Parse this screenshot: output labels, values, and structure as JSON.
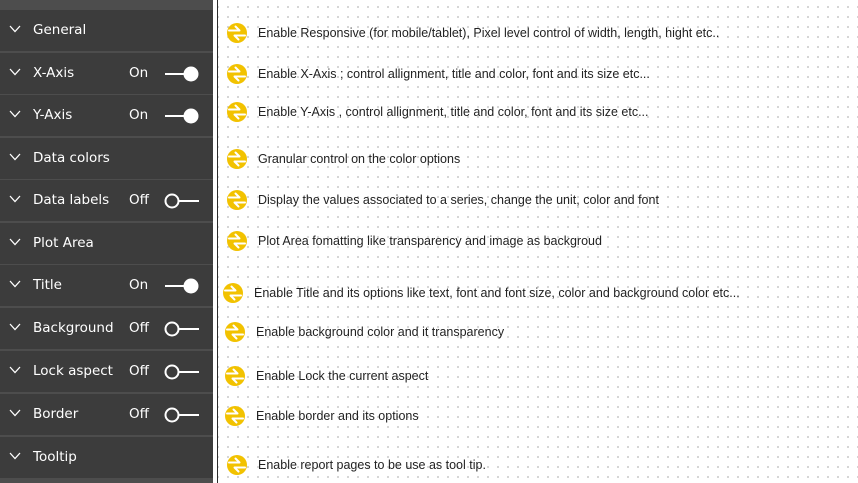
{
  "colors": {
    "panel_background": "#3c3c3c",
    "panel_text": "#ffffff",
    "bullet_fill": "#f2c200",
    "body_text": "#222222"
  },
  "icons": {
    "expander": "chevron-down-icon",
    "toggle": "toggle-switch-icon",
    "bullet": "yellow-arrow-bullet-icon"
  },
  "format_pane": {
    "items": [
      {
        "id": "general",
        "label": "General",
        "state": "",
        "description": "Enable Responsive (for mobile/tablet), Pixel level control of width, length, hight etc.."
      },
      {
        "id": "x-axis",
        "label": "X-Axis",
        "state": "On",
        "description": "Enable X-Axis ; control allignment, title and color, font and its size etc..."
      },
      {
        "id": "y-axis",
        "label": "Y-Axis",
        "state": "On",
        "description": "Enable Y-Axis , control allignment, title and color, font and its size etc..."
      },
      {
        "id": "data-colors",
        "label": "Data colors",
        "state": "",
        "description": "Granular control on the color options"
      },
      {
        "id": "data-labels",
        "label": "Data labels",
        "state": "Off",
        "description": "Display the values associated to a series, change the unit, color and font"
      },
      {
        "id": "plot-area",
        "label": "Plot Area",
        "state": "",
        "description": "Plot Area fomatting like transparency and image as backgroud"
      },
      {
        "id": "title",
        "label": "Title",
        "state": "On",
        "description": "Enable Title and its options like text, font and font size, color and background color etc..."
      },
      {
        "id": "background",
        "label": "Background",
        "state": "Off",
        "description": "Enable background color and it transparency"
      },
      {
        "id": "lock-aspect",
        "label": "Lock aspect",
        "state": "Off",
        "description": "Enable Lock the current aspect"
      },
      {
        "id": "border",
        "label": "Border",
        "state": "Off",
        "description": "Enable border and its options"
      },
      {
        "id": "tooltip",
        "label": "Tooltip",
        "state": "",
        "description": "Enable report pages to be use as tool tip."
      }
    ]
  }
}
